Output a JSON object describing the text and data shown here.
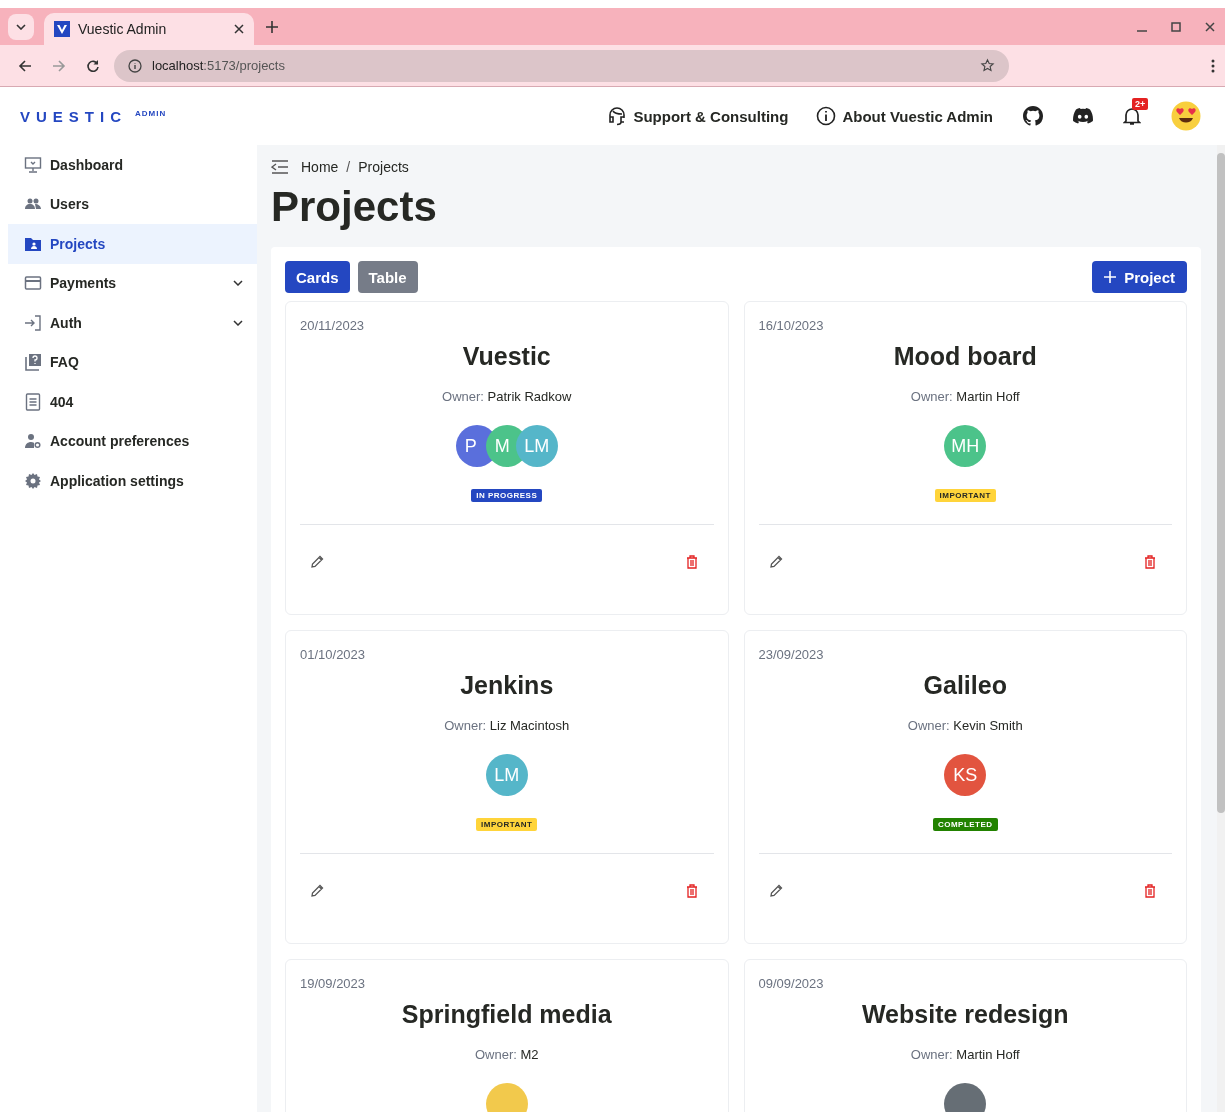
{
  "browser": {
    "tab_title": "Vuestic Admin",
    "url_host": "localhost",
    "url_path": ":5173/projects"
  },
  "header": {
    "logo": "VUESTIC",
    "logo_sub": "ADMIN",
    "links": [
      "Support & Consulting",
      "About Vuestic Admin"
    ],
    "notification_badge": "2+"
  },
  "sidebar": {
    "items": [
      {
        "label": "Dashboard",
        "kind": "monitor",
        "selected": false,
        "expandable": false
      },
      {
        "label": "Users",
        "kind": "users",
        "selected": false,
        "expandable": false
      },
      {
        "label": "Projects",
        "kind": "folder",
        "selected": true,
        "expandable": false
      },
      {
        "label": "Payments",
        "kind": "card",
        "selected": false,
        "expandable": true
      },
      {
        "label": "Auth",
        "kind": "login",
        "selected": false,
        "expandable": true
      },
      {
        "label": "FAQ",
        "kind": "faq",
        "selected": false,
        "expandable": false
      },
      {
        "label": "404",
        "kind": "doc",
        "selected": false,
        "expandable": false
      },
      {
        "label": "Account preferences",
        "kind": "account",
        "selected": false,
        "expandable": false
      },
      {
        "label": "Application settings",
        "kind": "gear",
        "selected": false,
        "expandable": false
      }
    ]
  },
  "breadcrumbs": {
    "items": [
      "Home",
      "Projects"
    ],
    "separator": "/"
  },
  "page_title": "Projects",
  "view_tabs": [
    {
      "label": "Cards",
      "selected": true
    },
    {
      "label": "Table",
      "selected": false
    }
  ],
  "add_button": "Project",
  "projects": [
    {
      "date": "20/11/2023",
      "name": "Vuestic",
      "owner_label": "Owner:",
      "owner": "Patrik Radkow",
      "team": [
        {
          "initials": "P",
          "color": "#5a6fdc"
        },
        {
          "initials": "M",
          "color": "#4cc38a"
        },
        {
          "initials": "LM",
          "color": "#55b6c9"
        }
      ],
      "status": {
        "label": "IN PROGRESS",
        "color": "#2447c1"
      }
    },
    {
      "date": "16/10/2023",
      "name": "Mood board",
      "owner_label": "Owner:",
      "owner": "Martin Hoff",
      "team": [
        {
          "initials": "MH",
          "color": "#4cc38a"
        }
      ],
      "status": {
        "label": "IMPORTANT",
        "color": "#ffd43a"
      }
    },
    {
      "date": "01/10/2023",
      "name": "Jenkins",
      "owner_label": "Owner:",
      "owner": "Liz Macintosh",
      "team": [
        {
          "initials": "LM",
          "color": "#55b6c9"
        }
      ],
      "status": {
        "label": "IMPORTANT",
        "color": "#ffd43a"
      }
    },
    {
      "date": "23/09/2023",
      "name": "Galileo",
      "owner_label": "Owner:",
      "owner": "Kevin Smith",
      "team": [
        {
          "initials": "KS",
          "color": "#e2543f"
        }
      ],
      "status": {
        "label": "COMPLETED",
        "color": "#228200"
      }
    },
    {
      "date": "19/09/2023",
      "name": "Springfield media",
      "owner_label": "Owner:",
      "owner": "M2",
      "team": [
        {
          "color": "#f2c94c"
        }
      ]
    },
    {
      "date": "09/09/2023",
      "name": "Website redesign",
      "owner_label": "Owner:",
      "owner": "Martin Hoff",
      "team": [
        {
          "color": "#666e75"
        }
      ]
    }
  ]
}
